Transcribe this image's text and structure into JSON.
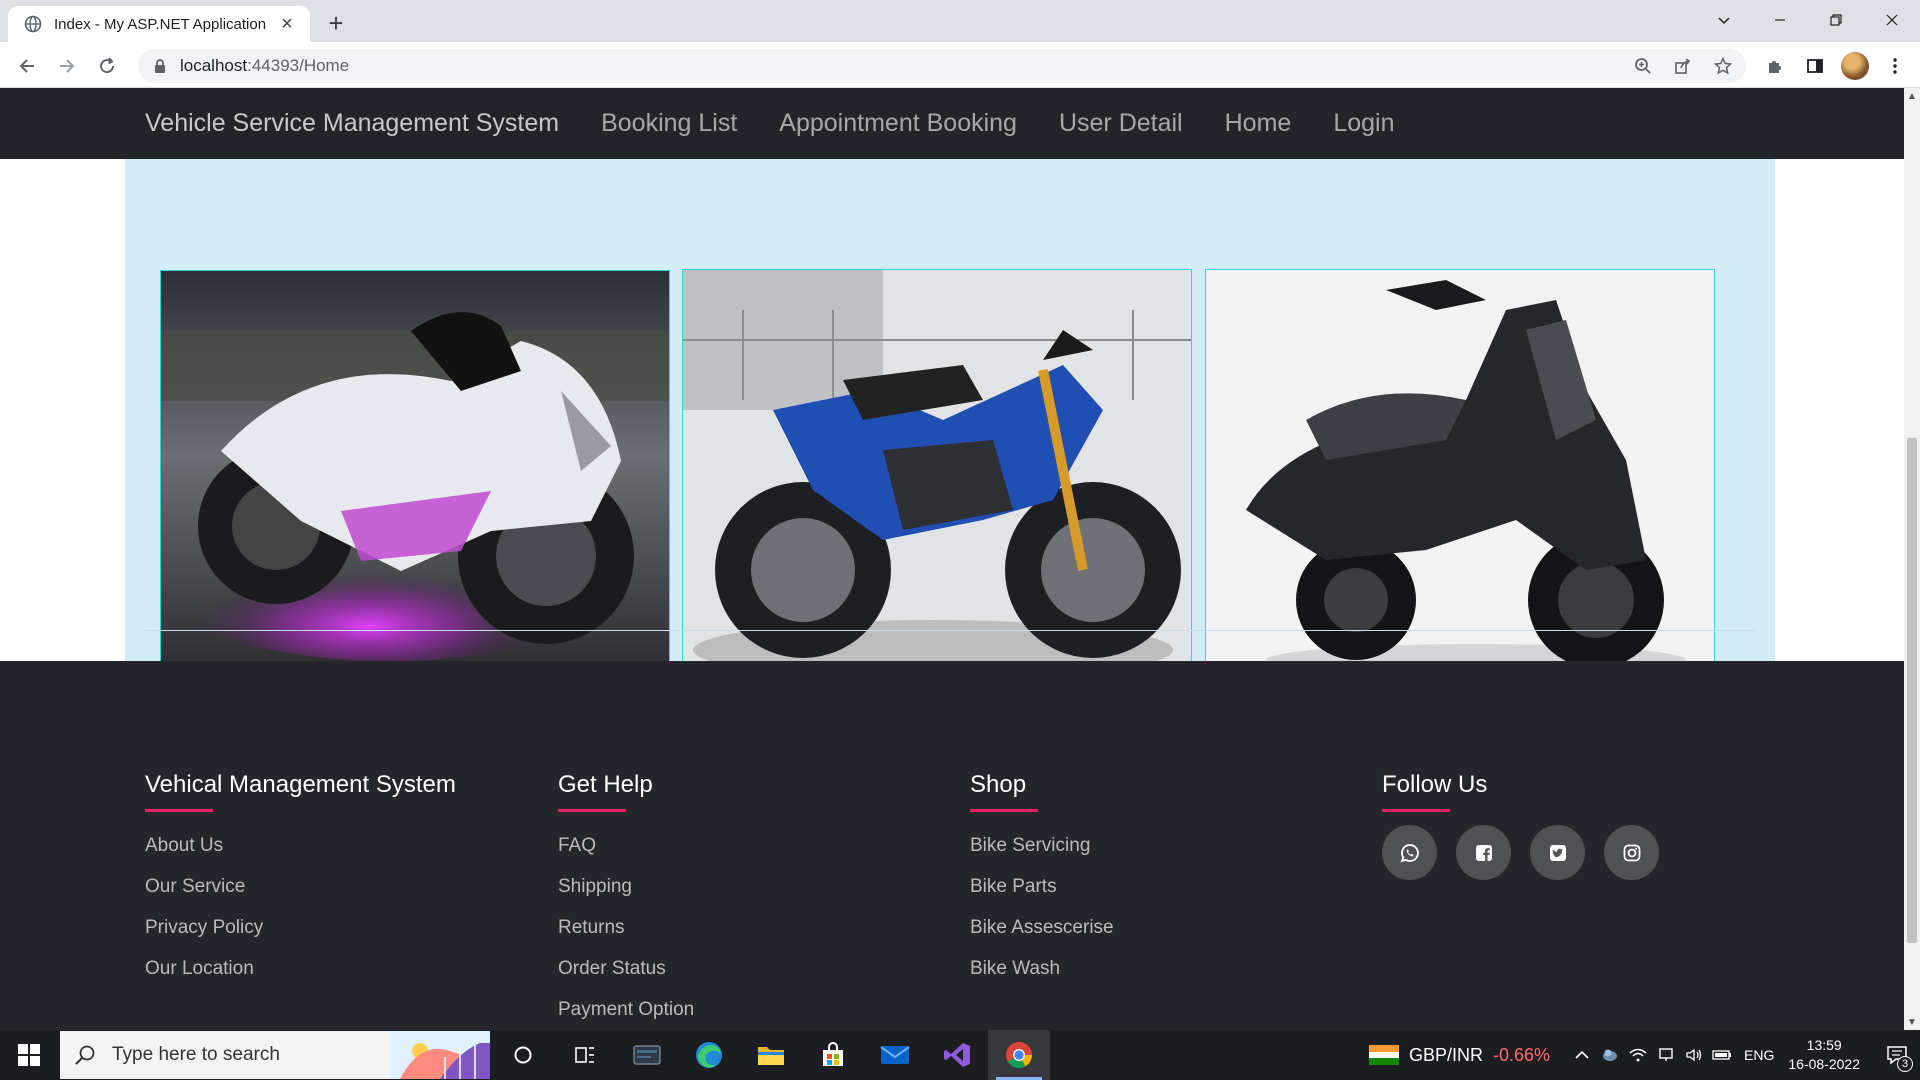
{
  "browser": {
    "tab_title": "Index - My ASP.NET Application",
    "url_host": "localhost",
    "url_rest": ":44393/Home"
  },
  "navbar": {
    "brand": "Vehicle Service Management System",
    "links": [
      "Booking List",
      "Appointment Booking",
      "User Detail",
      "Home",
      "Login"
    ]
  },
  "gallery": {
    "images": [
      "sport-bike-white-purple-glow",
      "naked-bike-blue",
      "scooter-black"
    ]
  },
  "footer": {
    "columns": [
      {
        "heading": "Vehical Management System",
        "links": [
          "About Us",
          "Our Service",
          "Privacy Policy",
          "Our Location"
        ]
      },
      {
        "heading": "Get Help",
        "links": [
          "FAQ",
          "Shipping",
          "Returns",
          "Order Status",
          "Payment Option"
        ]
      },
      {
        "heading": "Shop",
        "links": [
          "Bike Servicing",
          "Bike Parts",
          "Bike Assescerise",
          "Bike Wash"
        ]
      },
      {
        "heading": "Follow Us",
        "social": [
          "whatsapp-icon",
          "facebook-icon",
          "twitter-icon",
          "instagram-icon"
        ]
      }
    ],
    "accent_color": "#e91e63"
  },
  "taskbar": {
    "search_placeholder": "Type here to search",
    "ticker_symbol": "GBP/INR",
    "ticker_change": "-0.66%",
    "language": "ENG",
    "time": "13:59",
    "date": "16-08-2022",
    "notification_count": "3"
  }
}
